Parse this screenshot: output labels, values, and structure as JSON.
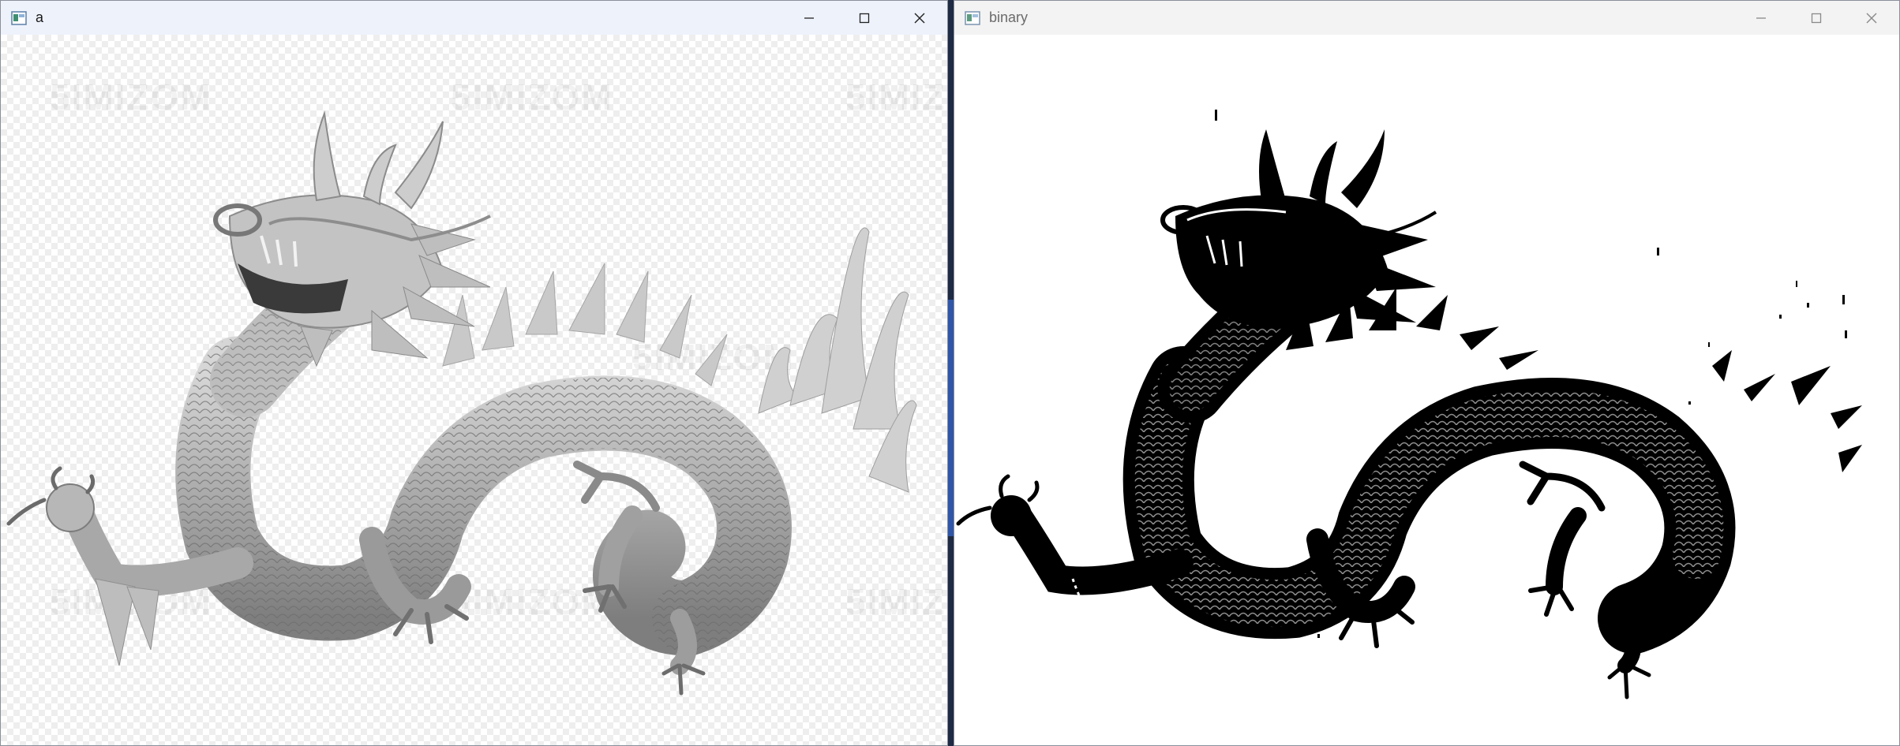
{
  "windows": [
    {
      "title": "a",
      "icon": "opencv-window-icon",
      "buttons": [
        "minimize-icon",
        "maximize-icon",
        "close-icon"
      ],
      "watermark": "5IMIZOM",
      "image_mode": "grayscale"
    },
    {
      "title": "binary",
      "icon": "opencv-window-icon",
      "buttons": [
        "minimize-icon",
        "maximize-icon",
        "close-icon"
      ],
      "image_mode": "binary"
    }
  ],
  "colors": {
    "active_titlebar": "#eef2fb",
    "inactive_titlebar": "#f3f3f3",
    "dragon_gray": "#9a9a9a",
    "dragon_binary": "#000000"
  }
}
